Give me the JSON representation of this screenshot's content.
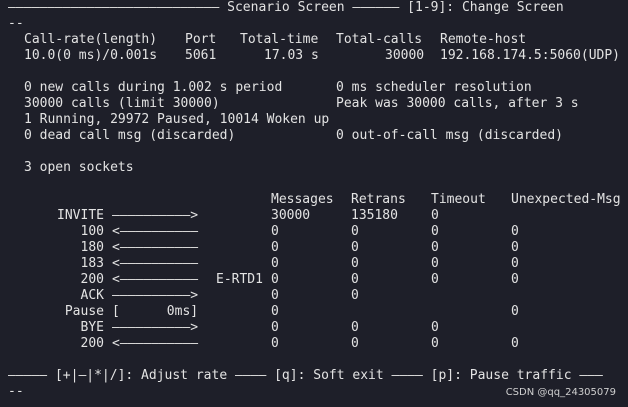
{
  "header": {
    "title_line": "——————————————————————————— Scenario Screen —————— [1-9]: Change Screen",
    "continuation": "--"
  },
  "summary": {
    "headers": [
      "Call-rate(length)",
      "Port",
      "Total-time",
      "Total-calls",
      "Remote-host"
    ],
    "values": [
      "10.0(0 ms)/0.001s",
      "5061",
      "17.03 s",
      "30000",
      "192.168.174.5:5060(UDP)"
    ]
  },
  "stats": {
    "line1_left": "0 new calls during 1.002 s period",
    "line1_right": "0 ms scheduler resolution",
    "line2_left": "30000 calls (limit 30000)",
    "line2_right": "Peak was 30000 calls, after 3 s",
    "line3": "1 Running, 29972 Paused, 10014 Woken up",
    "line4_left": "0 dead call msg (discarded)",
    "line4_right": "0 out-of-call msg (discarded)",
    "sockets": "3 open sockets"
  },
  "table": {
    "headers": [
      "Messages",
      "Retrans",
      "Timeout",
      "Unexpected-Msg"
    ],
    "rows": [
      {
        "name": "INVITE",
        "arrow": "——————————>",
        "note": "",
        "messages": "30000",
        "retrans": "135180",
        "timeout": "0",
        "unexpected": ""
      },
      {
        "name": "100",
        "arrow": "<——————————",
        "note": "",
        "messages": "0",
        "retrans": "0",
        "timeout": "0",
        "unexpected": "0"
      },
      {
        "name": "180",
        "arrow": "<——————————",
        "note": "",
        "messages": "0",
        "retrans": "0",
        "timeout": "0",
        "unexpected": "0"
      },
      {
        "name": "183",
        "arrow": "<——————————",
        "note": "",
        "messages": "0",
        "retrans": "0",
        "timeout": "0",
        "unexpected": "0"
      },
      {
        "name": "200",
        "arrow": "<——————————",
        "note": "E-RTD1",
        "messages": "0",
        "retrans": "0",
        "timeout": "0",
        "unexpected": "0"
      },
      {
        "name": "ACK",
        "arrow": "——————————>",
        "note": "",
        "messages": "0",
        "retrans": "0",
        "timeout": "",
        "unexpected": ""
      },
      {
        "name": "Pause",
        "arrow": "[      0ms]",
        "note": "",
        "messages": "0",
        "retrans": "",
        "timeout": "",
        "unexpected": "0"
      },
      {
        "name": "BYE",
        "arrow": "——————————>",
        "note": "",
        "messages": "0",
        "retrans": "0",
        "timeout": "0",
        "unexpected": ""
      },
      {
        "name": "200",
        "arrow": "<——————————",
        "note": "",
        "messages": "0",
        "retrans": "0",
        "timeout": "0",
        "unexpected": "0"
      }
    ]
  },
  "footer": {
    "line": "————— [+|—|*|/]: Adjust rate ———— [q]: Soft exit ———— [p]: Pause traffic ———",
    "continuation": "--"
  },
  "watermark": "CSDN @qq_24305079",
  "colors": {
    "background": "#1e1f29",
    "text": "#e3e3e3"
  }
}
